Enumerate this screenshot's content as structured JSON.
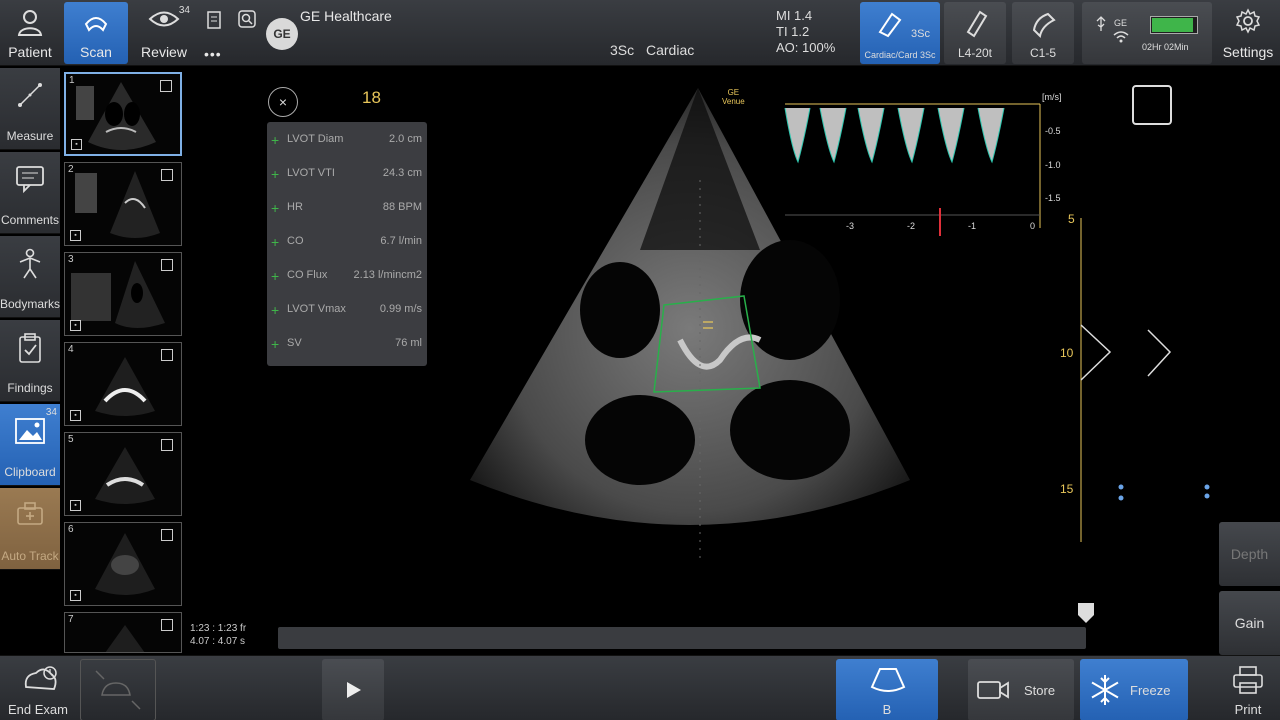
{
  "topbar": {
    "patient_label": "Patient",
    "scan_label": "Scan",
    "review_label": "Review",
    "review_badge": "34",
    "more_label": "•••",
    "brand_logo": "GE",
    "brand_name": "GE Healthcare",
    "probe_code": "3Sc",
    "application": "Cardiac",
    "mi": "MI 1.4",
    "ti": "TI 1.2",
    "ao": "AO: 100%",
    "probes": [
      {
        "name": "3Sc",
        "sub": "Cardiac/Card 3Sc",
        "active": true
      },
      {
        "name": "L4-20t",
        "active": false
      },
      {
        "name": "C1-5",
        "active": false
      }
    ],
    "status_ge": "GE",
    "battery_time": "02Hr 02Min",
    "battery_level": 0.9,
    "settings_label": "Settings"
  },
  "left_tools": [
    {
      "label": "Measure",
      "icon": "measure-icon"
    },
    {
      "label": "Comments",
      "icon": "comment-icon"
    },
    {
      "label": "Bodymarks",
      "icon": "bodymark-icon"
    },
    {
      "label": "Findings",
      "icon": "findings-icon"
    },
    {
      "label": "Clipboard",
      "icon": "clipboard-icon",
      "badge": "34"
    },
    {
      "label": "Auto Track",
      "icon": "auto-track-icon"
    }
  ],
  "thumbnails": [
    "1",
    "2",
    "3",
    "4",
    "5",
    "6",
    "7"
  ],
  "measurements": {
    "close": "×",
    "frame": "18",
    "rows": [
      {
        "label": "LVOT Diam",
        "value": "2.0 cm"
      },
      {
        "label": "LVOT VTI",
        "value": "24.3 cm"
      },
      {
        "label": "HR",
        "value": "88 BPM"
      },
      {
        "label": "CO",
        "value": "6.7 l/min"
      },
      {
        "label": "CO Flux",
        "value": "2.13 l/mincm2"
      },
      {
        "label": "LVOT Vmax",
        "value": "0.99 m/s"
      },
      {
        "label": "SV",
        "value": "76 ml"
      }
    ]
  },
  "vendor_text": "GE\nVenue",
  "doppler": {
    "unit": "[m/s]",
    "y_ticks": [
      "-0.5",
      "-1.0",
      "-1.5"
    ],
    "x_ticks": [
      "-3",
      "-2",
      "-1",
      "0"
    ]
  },
  "depth_scale": [
    "5",
    "10",
    "15"
  ],
  "timeline": {
    "frames": "1:23 : 1:23 fr",
    "time": "4.07 : 4.07 s"
  },
  "right_controls": {
    "depth_label": "Depth",
    "gain_label": "Gain"
  },
  "bottombar": {
    "end_exam_label": "End Exam",
    "b_mode_label": "B",
    "store_label": "Store",
    "freeze_label": "Freeze",
    "print_label": "Print"
  }
}
